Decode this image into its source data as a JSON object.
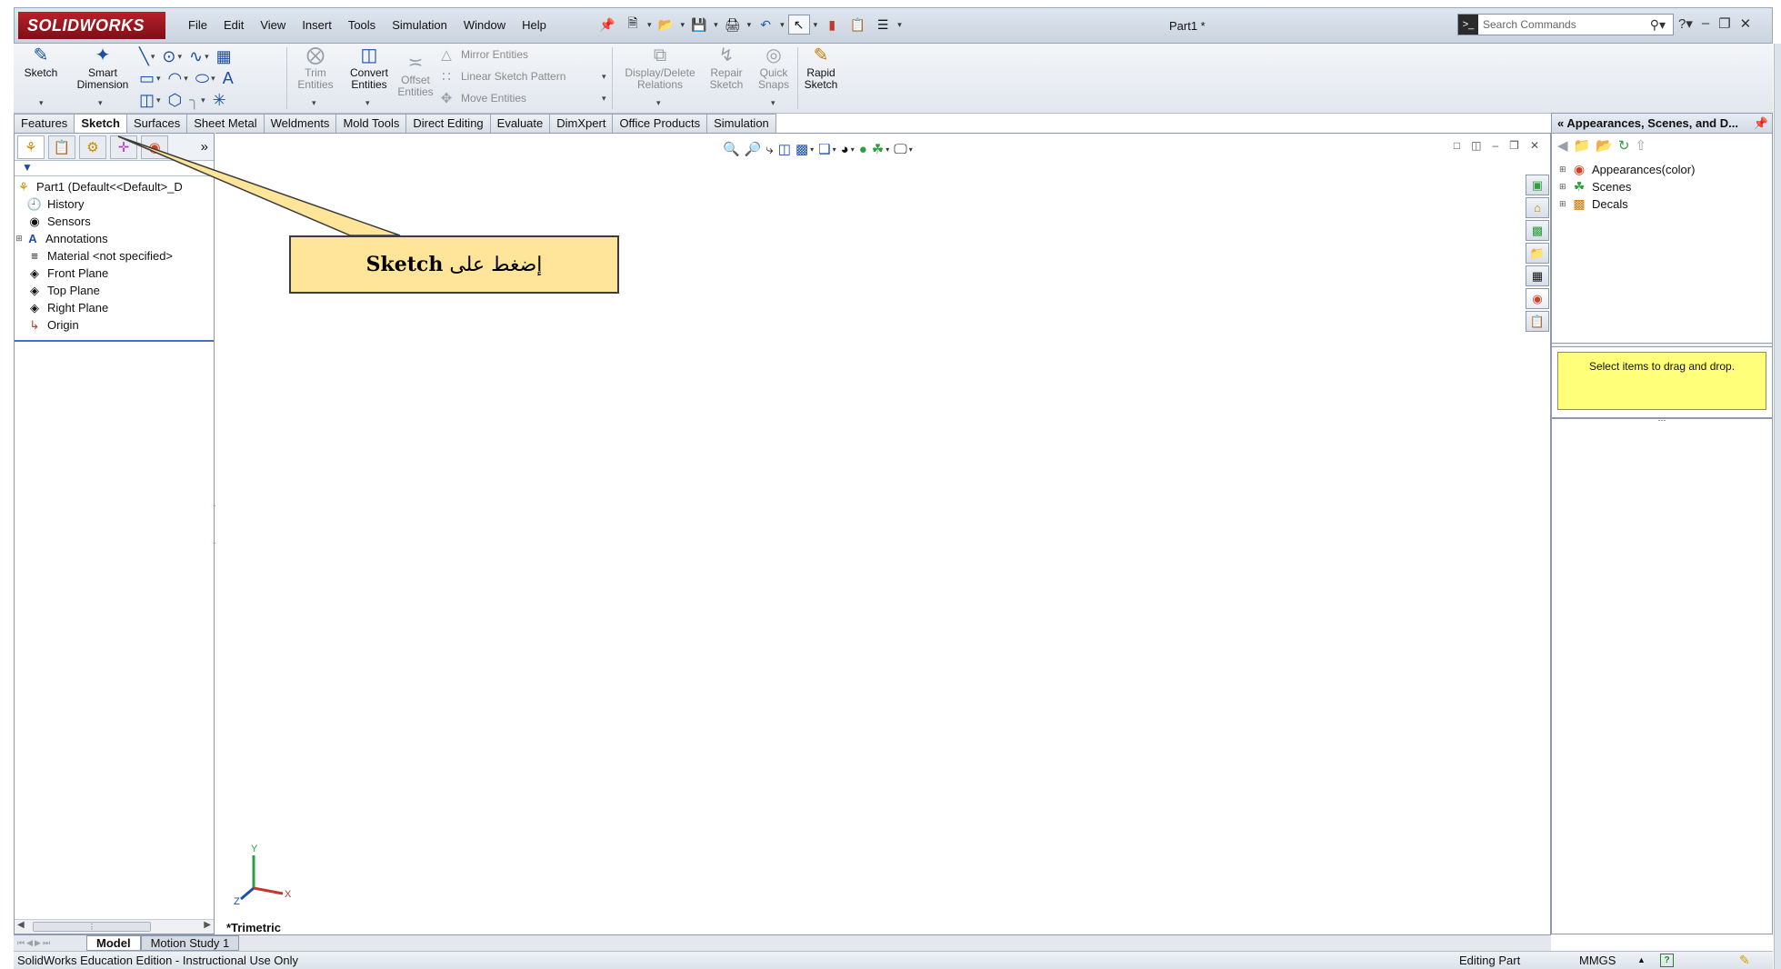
{
  "app": {
    "logo": "SOLIDWORKS",
    "doc_title": "Part1 *",
    "menu": [
      "File",
      "Edit",
      "View",
      "Insert",
      "Tools",
      "Simulation",
      "Window",
      "Help"
    ],
    "search_placeholder": "Search Commands"
  },
  "commands": {
    "sketch": "Sketch",
    "smart_dimension": [
      "Smart",
      "Dimension"
    ],
    "trim_entities": [
      "Trim",
      "Entities"
    ],
    "convert_entities": [
      "Convert",
      "Entities"
    ],
    "offset_entities": [
      "Offset",
      "Entities"
    ],
    "mirror_entities": "Mirror Entities",
    "linear_sketch_pattern": "Linear Sketch Pattern",
    "move_entities": "Move Entities",
    "display_delete_relations": [
      "Display/Delete",
      "Relations"
    ],
    "repair_sketch": [
      "Repair",
      "Sketch"
    ],
    "quick_snaps": [
      "Quick",
      "Snaps"
    ],
    "rapid_sketch": [
      "Rapid",
      "Sketch"
    ]
  },
  "tabs": [
    "Features",
    "Sketch",
    "Surfaces",
    "Sheet Metal",
    "Weldments",
    "Mold Tools",
    "Direct Editing",
    "Evaluate",
    "DimXpert",
    "Office Products",
    "Simulation"
  ],
  "active_tab": "Sketch",
  "feature_tree": {
    "root": "Part1  (Default<<Default>_D",
    "items": [
      {
        "label": "History",
        "icon": "history-icon",
        "expandable": false
      },
      {
        "label": "Sensors",
        "icon": "sensors-icon",
        "expandable": false
      },
      {
        "label": "Annotations",
        "icon": "annotations-icon",
        "expandable": true
      },
      {
        "label": "Material <not specified>",
        "icon": "material-icon",
        "expandable": false
      },
      {
        "label": "Front Plane",
        "icon": "plane-icon",
        "expandable": false
      },
      {
        "label": "Top Plane",
        "icon": "plane-icon",
        "expandable": false
      },
      {
        "label": "Right Plane",
        "icon": "plane-icon",
        "expandable": false
      },
      {
        "label": "Origin",
        "icon": "origin-icon",
        "expandable": false
      }
    ]
  },
  "graphics": {
    "view_name": "*Trimetric",
    "triad": {
      "x": "X",
      "y": "Y",
      "z": "Z"
    }
  },
  "callout": {
    "text_ar": "إضغط على",
    "text_bold": "Sketch"
  },
  "task_pane": {
    "title": "Appearances, Scenes, and D...",
    "items": [
      {
        "label": "Appearances(color)",
        "icon": "appearances-icon"
      },
      {
        "label": "Scenes",
        "icon": "scenes-icon"
      },
      {
        "label": "Decals",
        "icon": "decals-icon"
      }
    ],
    "hint": "Select items to drag and drop."
  },
  "bottom_tabs": [
    "Model",
    "Motion Study 1"
  ],
  "active_bottom_tab": "Model",
  "status": {
    "left": "SolidWorks Education Edition - Instructional Use Only",
    "mode": "Editing Part",
    "units": "MMGS"
  },
  "colors": {
    "callout_fill": "#ffe599",
    "hint_fill": "#ffff7a",
    "logo_red": "#b8202a",
    "selection_blue": "#3b73c8"
  }
}
